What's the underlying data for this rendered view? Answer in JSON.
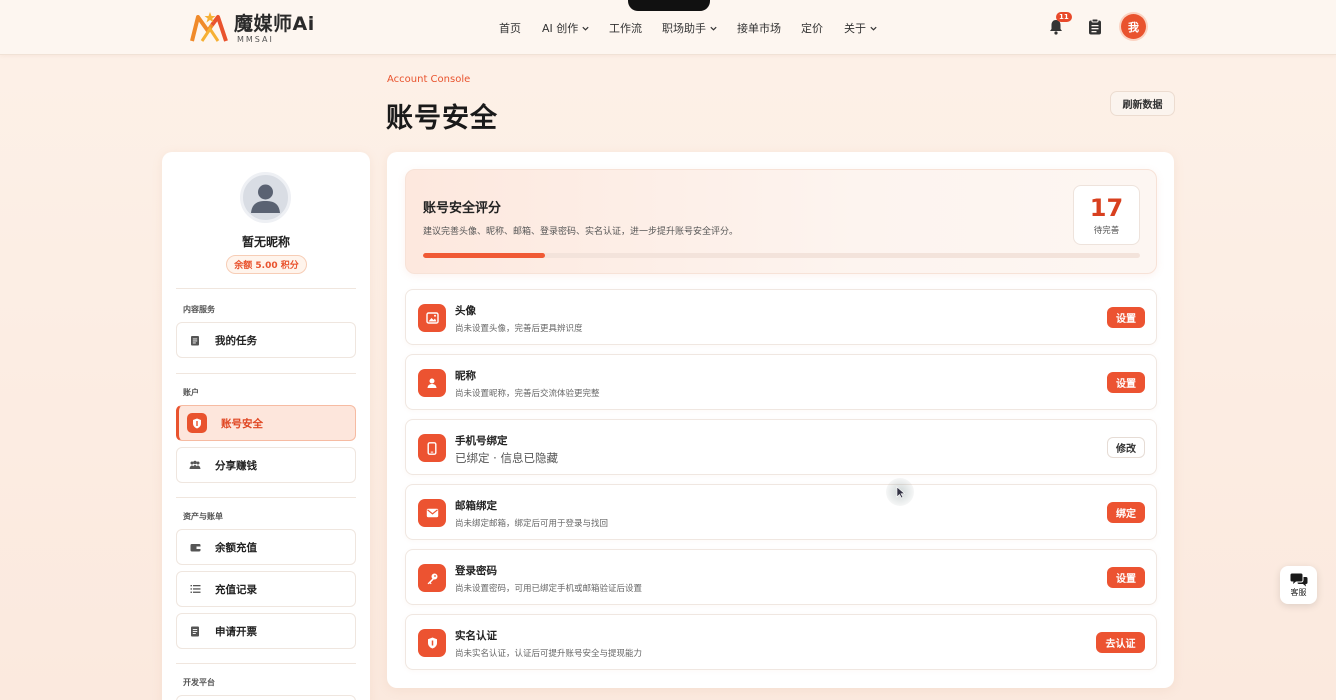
{
  "brand": {
    "name": "魔媒师Ai",
    "sub": "MMSAI"
  },
  "nav": {
    "items": [
      {
        "label": "首页"
      },
      {
        "label": "AI 创作"
      },
      {
        "label": "工作流"
      },
      {
        "label": "职场助手"
      },
      {
        "label": "接单市场"
      },
      {
        "label": "定价"
      },
      {
        "label": "关于"
      }
    ],
    "notification_count": "11",
    "avatar_text": "我"
  },
  "header": {
    "eyebrow": "Account Console",
    "title": "账号安全",
    "refresh_label": "刷新数据"
  },
  "profile": {
    "nickname": "暂无昵称",
    "balance": "余额 5.00 积分"
  },
  "sidebar": {
    "sections": [
      {
        "label": "内容服务"
      },
      {
        "label": "账户"
      },
      {
        "label": "资产与账单"
      },
      {
        "label": "开发平台"
      }
    ],
    "items": [
      {
        "label": "我的任务"
      },
      {
        "label": "账号安全"
      },
      {
        "label": "分享赚钱"
      },
      {
        "label": "余额充值"
      },
      {
        "label": "充值记录"
      },
      {
        "label": "申请开票"
      }
    ]
  },
  "score": {
    "title": "账号安全评分",
    "desc": "建议完善头像、昵称、邮箱、登录密码、实名认证，进一步提升账号安全评分。",
    "value": "17",
    "status": "待完善",
    "progress_percent": 17
  },
  "rows": [
    {
      "title": "头像",
      "desc": "尚未设置头像，完善后更具辨识度",
      "button": "设置",
      "icon": "image-icon"
    },
    {
      "title": "昵称",
      "desc": "尚未设置昵称，完善后交流体验更完整",
      "button": "设置",
      "icon": "user-icon"
    },
    {
      "title": "手机号绑定",
      "desc": "已绑定 · 信息已隐藏",
      "button": "修改",
      "icon": "phone-icon"
    },
    {
      "title": "邮箱绑定",
      "desc": "尚未绑定邮箱，绑定后可用于登录与找回",
      "button": "绑定",
      "icon": "mail-icon"
    },
    {
      "title": "登录密码",
      "desc": "尚未设置密码，可用已绑定手机或邮箱验证后设置",
      "button": "设置",
      "icon": "key-icon"
    },
    {
      "title": "实名认证",
      "desc": "尚未实名认证，认证后可提升账号安全与提现能力",
      "button": "去认证",
      "icon": "shield-icon"
    }
  ],
  "support_label": "客服",
  "colors": {
    "accent": "#ec5331",
    "score": "#d8401f",
    "bg": "#fdf1e8"
  }
}
